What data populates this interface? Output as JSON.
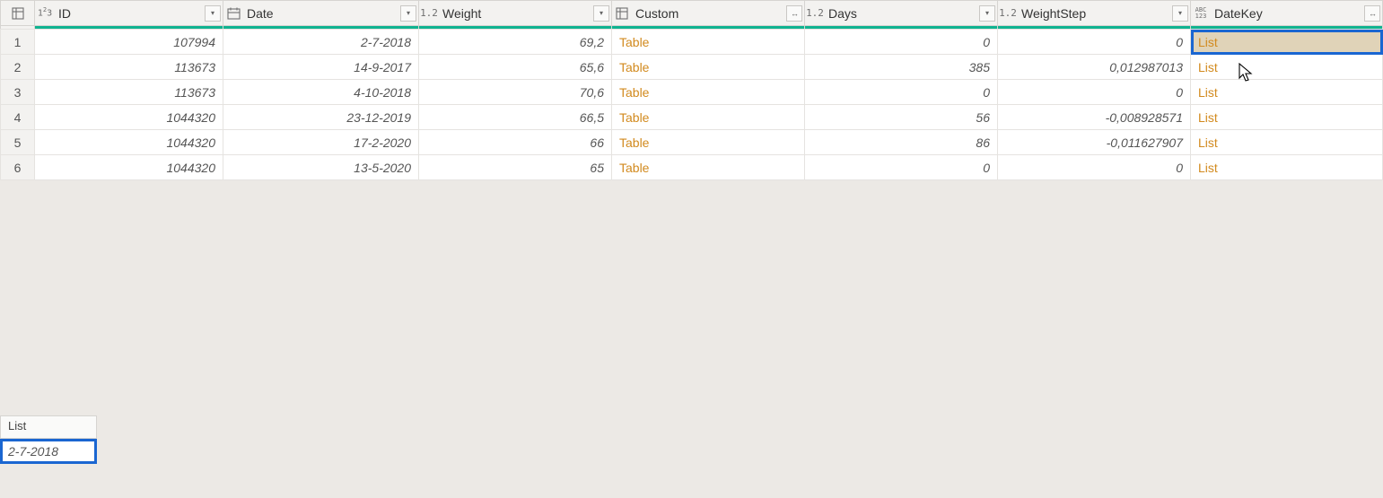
{
  "columns": [
    {
      "type": "int",
      "label": "ID",
      "button": "dropdown"
    },
    {
      "type": "date",
      "label": "Date",
      "button": "dropdown"
    },
    {
      "type": "dec",
      "label": "Weight",
      "button": "dropdown"
    },
    {
      "type": "tbl",
      "label": "Custom",
      "button": "expand"
    },
    {
      "type": "dec",
      "label": "Days",
      "button": "dropdown"
    },
    {
      "type": "dec",
      "label": "WeightStep",
      "button": "dropdown"
    },
    {
      "type": "any",
      "label": "DateKey",
      "button": "expand"
    }
  ],
  "typeLabels": {
    "int": "1²3",
    "dec": "1.2",
    "any": "ABC\n123"
  },
  "rows": [
    {
      "n": "1",
      "id": "107994",
      "date": "2-7-2018",
      "weight": "69,2",
      "custom": "Table",
      "days": "0",
      "step": "0",
      "key": "List"
    },
    {
      "n": "2",
      "id": "113673",
      "date": "14-9-2017",
      "weight": "65,6",
      "custom": "Table",
      "days": "385",
      "step": "0,012987013",
      "key": "List"
    },
    {
      "n": "3",
      "id": "113673",
      "date": "4-10-2018",
      "weight": "70,6",
      "custom": "Table",
      "days": "0",
      "step": "0",
      "key": "List"
    },
    {
      "n": "4",
      "id": "1044320",
      "date": "23-12-2019",
      "weight": "66,5",
      "custom": "Table",
      "days": "56",
      "step": "-0,008928571",
      "key": "List"
    },
    {
      "n": "5",
      "id": "1044320",
      "date": "17-2-2020",
      "weight": "66",
      "custom": "Table",
      "days": "86",
      "step": "-0,011627907",
      "key": "List"
    },
    {
      "n": "6",
      "id": "1044320",
      "date": "13-5-2020",
      "weight": "65",
      "custom": "Table",
      "days": "0",
      "step": "0",
      "key": "List"
    }
  ],
  "colWidths": {
    "rownum": 38,
    "id": 210,
    "date": 218,
    "weight": 215,
    "custom": 215,
    "days": 215,
    "step": 215,
    "key": 215
  },
  "selected": {
    "row": 0,
    "col": "key"
  },
  "preview": {
    "header": "List",
    "value": "2-7-2018"
  }
}
